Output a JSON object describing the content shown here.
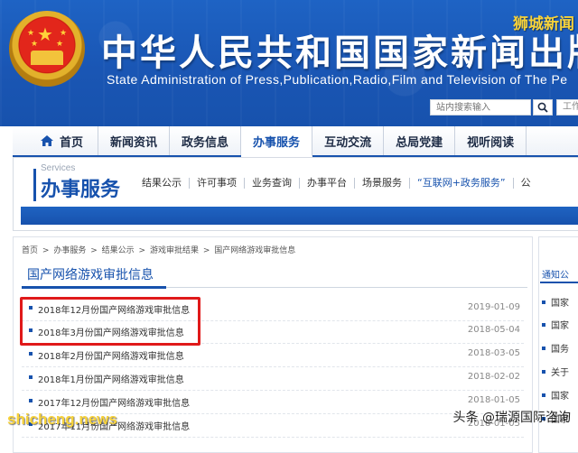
{
  "header": {
    "title_cn": "中华人民共和国国家新闻出版",
    "title_en": "State Administration of Press,Publication,Radio,Film and Television of The Pe",
    "watermark_top": "狮城新闻",
    "search_placeholder": "站内搜索输入",
    "extra_input_text": "工作"
  },
  "nav": {
    "items": [
      "首页",
      "新闻资讯",
      "政务信息",
      "办事服务",
      "互动交流",
      "总局党建",
      "视听阅读"
    ],
    "active": "办事服务"
  },
  "services": {
    "label_en": "Services",
    "title": "办事服务",
    "links": [
      "结果公示",
      "许可事项",
      "业务查询",
      "办事平台",
      "场景服务",
      "“互联网+政务服务”"
    ],
    "extra": "公"
  },
  "breadcrumb": [
    "首页",
    ">",
    "办事服务",
    ">",
    "结果公示",
    ">",
    "游戏审批结果",
    ">",
    "国产网络游戏审批信息"
  ],
  "list": {
    "title": "国产网络游戏审批信息",
    "rows": [
      {
        "title": "2018年12月份国产网络游戏审批信息",
        "date": "2019-01-09"
      },
      {
        "title": "2018年3月份国产网络游戏审批信息",
        "date": "2018-05-04"
      },
      {
        "title": "2018年2月份国产网络游戏审批信息",
        "date": "2018-03-05"
      },
      {
        "title": "2018年1月份国产网络游戏审批信息",
        "date": "2018-02-02"
      },
      {
        "title": "2017年12月份国产网络游戏审批信息",
        "date": "2018-01-05"
      },
      {
        "title": "2017年11月份国产网络游戏审批信息",
        "date": "2018-01-05"
      }
    ]
  },
  "side": {
    "title": "通知公",
    "items": [
      "国家",
      "国家",
      "国务",
      "关于",
      "国家",
      "国家"
    ]
  },
  "watermarks": {
    "bottom_left": "shicheng.news",
    "bottom_right": "头条 @瑞源国际咨询"
  },
  "colors": {
    "primary": "#1752ad",
    "highlight": "#e0191a",
    "watermark": "#f7d23a"
  }
}
